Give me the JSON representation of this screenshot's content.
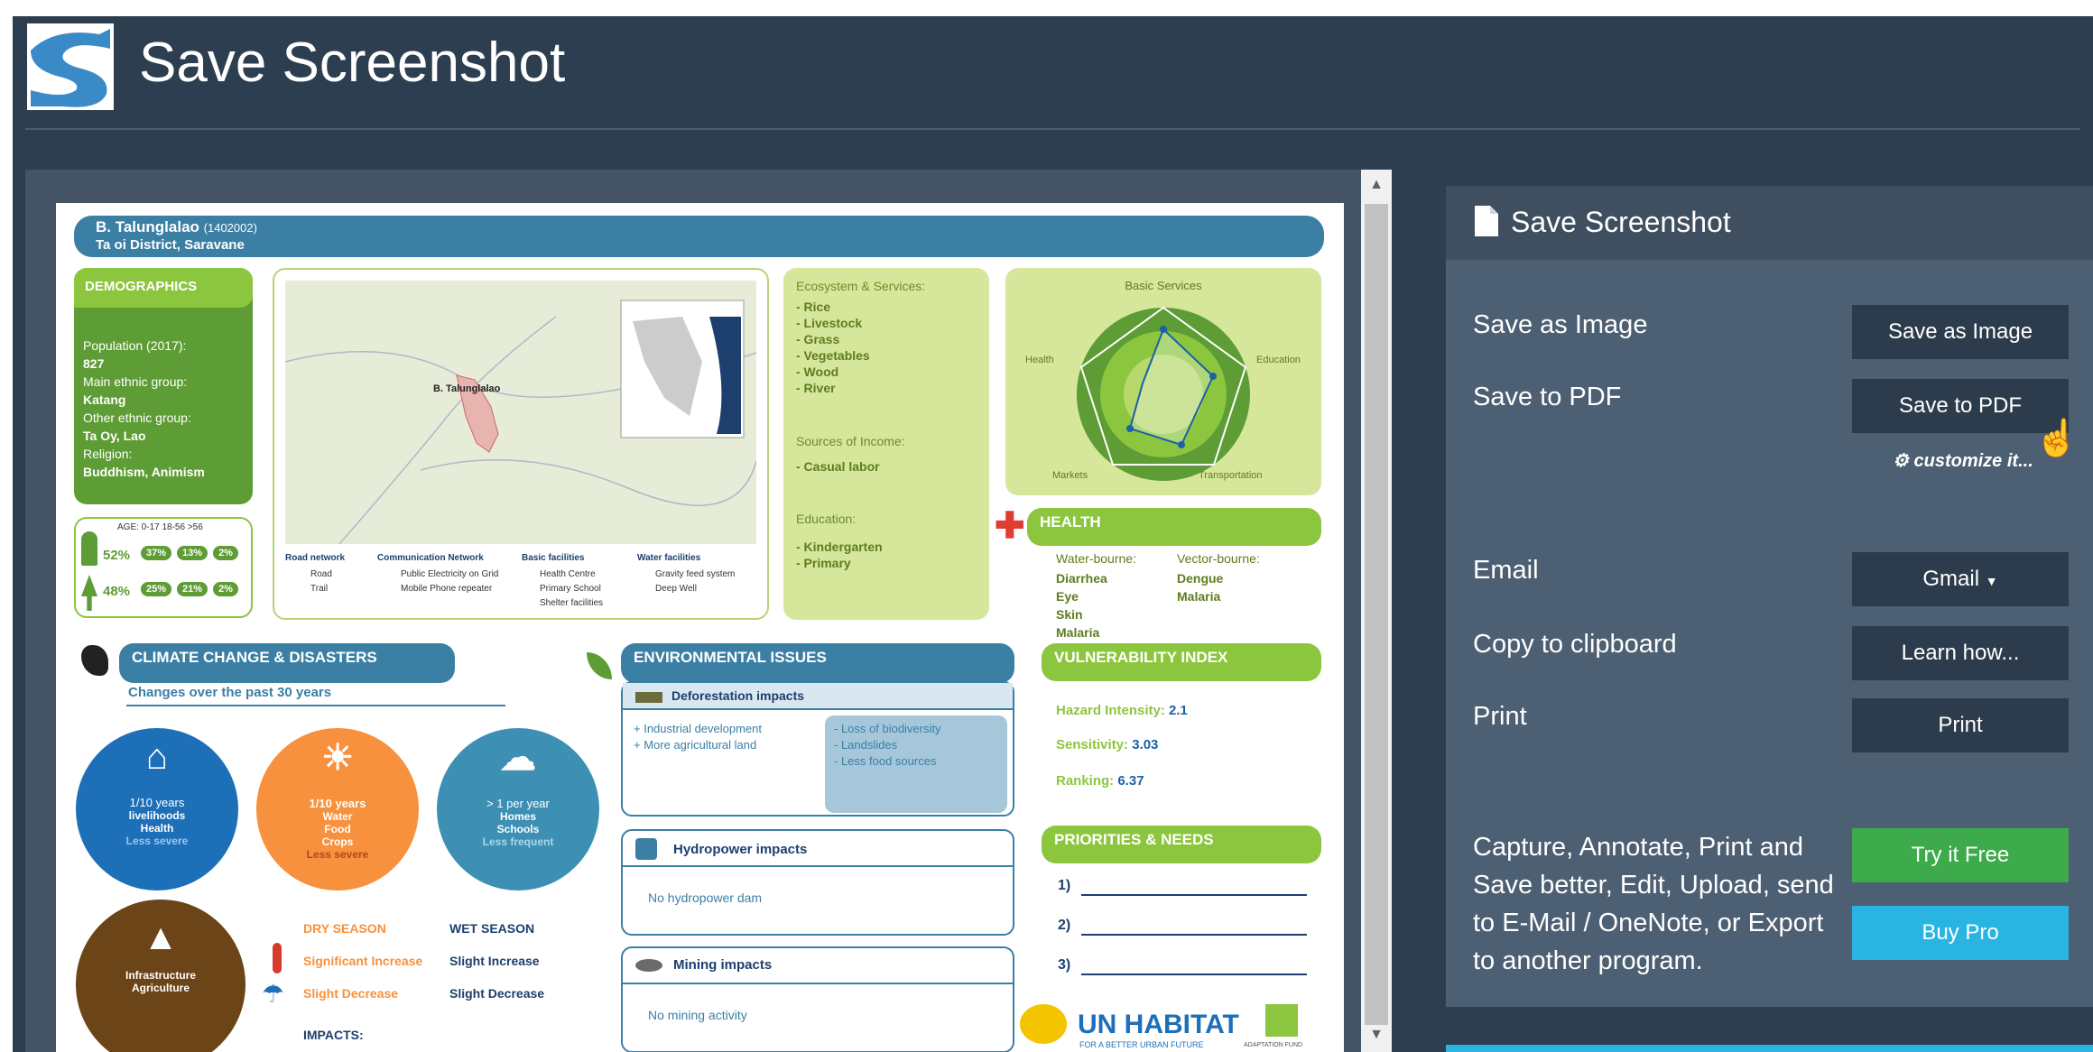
{
  "header": {
    "title": "Save Screenshot"
  },
  "document": {
    "village": "B. Talunglalao",
    "code": "(1402002)",
    "district": "Ta oi District, Saravane",
    "demographics": {
      "title": "DEMOGRAPHICS",
      "pop_label": "Population (2017):",
      "pop_value": "827",
      "ethnic_label": "Main ethnic group:",
      "ethnic_value": "Katang",
      "other_label": "Other ethnic group:",
      "other_value": "Ta Oy, Lao",
      "religion_label": "Religion:",
      "religion_value": "Buddhism, Animism"
    },
    "age": {
      "header": "AGE: 0-17  18-56  >56",
      "male_pct": "52%",
      "male_vals": [
        "37%",
        "13%",
        "2%"
      ],
      "female_pct": "48%",
      "female_vals": [
        "25%",
        "21%",
        "2%"
      ]
    },
    "map": {
      "place": "B. Talunglalao",
      "legend_road": "Road network",
      "legend_comm": "Communication Network",
      "legend_basic": "Basic facilities",
      "legend_water": "Water facilities",
      "road": "Road",
      "trail": "Trail",
      "electricity": "Public Electricity on Grid",
      "phone": "Mobile Phone repeater",
      "health": "Health Centre",
      "school": "Primary School",
      "shelter": "Shelter facilities",
      "gravity": "Gravity feed system",
      "well": "Deep Well"
    },
    "eco": {
      "title": "Ecosystem & Services:",
      "items": [
        "- Rice",
        "- Livestock",
        "- Grass",
        "- Vegetables",
        "- Wood",
        "- River"
      ],
      "income_title": "Sources of Income:",
      "income_items": [
        "- Casual labor"
      ],
      "edu_title": "Education:",
      "edu_items": [
        "- Kindergarten",
        "- Primary"
      ]
    },
    "radar": {
      "title": "Basic Services",
      "health": "Health",
      "education": "Education",
      "markets": "Markets",
      "transport": "Transportation"
    },
    "health": {
      "title": "HEALTH",
      "water_title": "Water-bourne:",
      "water_items": [
        "Diarrhea",
        "Eye",
        "Skin",
        "Malaria"
      ],
      "vector_title": "Vector-bourne:",
      "vector_items": [
        "Dengue",
        "Malaria"
      ]
    },
    "vulnerability": {
      "title": "VULNERABILITY INDEX",
      "hazard_label": "Hazard Intensity:",
      "hazard": "2.1",
      "sens_label": "Sensitivity:",
      "sens": "3.03",
      "rank_label": "Ranking:",
      "rank": "6.37"
    },
    "priorities": {
      "title": "PRIORITIES & NEEDS",
      "items": [
        "1)",
        "2)",
        "3)"
      ]
    },
    "climate": {
      "title": "CLIMATE CHANGE & DISASTERS",
      "subtitle": "Changes over the past 30 years",
      "c1": [
        "1/10 years",
        "livelihoods",
        "Health",
        "Less severe"
      ],
      "c2": [
        "1/10 years",
        "Water",
        "Food",
        "Crops",
        "Less severe"
      ],
      "c3": [
        "> 1 per year",
        "Homes",
        "Schools",
        "Less frequent"
      ],
      "c4": [
        "Infrastructure",
        "Agriculture"
      ],
      "dry": "DRY SEASON",
      "wet": "WET SEASON",
      "sig_inc": "Significant Increase",
      "slight_inc": "Slight Increase",
      "slight_dec": "Slight Decrease",
      "slight_dec2": "Slight Decrease",
      "impacts": "IMPACTS:"
    },
    "env": {
      "title": "ENVIRONMENTAL ISSUES",
      "defor": "Deforestation impacts",
      "left": [
        "+ Industrial development",
        "+ More agricultural land"
      ],
      "right": [
        "- Loss of biodiversity",
        "- Landslides",
        "- Less food sources"
      ],
      "hydro": "Hydropower impacts",
      "hydro_text": "No hydropower dam",
      "mining": "Mining impacts",
      "mining_text": "No mining activity"
    },
    "logos": {
      "unhabitat": "UN HABITAT",
      "unhabitat_sub": "FOR A BETTER URBAN FUTURE",
      "adaptation": "ADAPTATION FUND"
    }
  },
  "panel": {
    "title": "Save Screenshot",
    "save_image_label": "Save as Image",
    "save_image_btn": "Save as Image",
    "save_pdf_label": "Save to PDF",
    "save_pdf_btn": "Save to PDF",
    "customize": "customize it...",
    "email_label": "Email",
    "email_btn": "Gmail",
    "clipboard_label": "Copy to clipboard",
    "clipboard_btn": "Learn how...",
    "print_label": "Print",
    "print_btn": "Print",
    "promo": "Capture, Annotate, Print and Save better, Edit, Upload, send to E-Mail / OneNote, or Export to another program.",
    "try_btn": "Try it Free",
    "buy_btn": "Buy Pro"
  },
  "colors": {
    "header_bg": "#2c3e50",
    "panel_bg": "#4d5f72",
    "green": "#3daa4b",
    "blue": "#29b4e2",
    "doc_blue": "#3b7fa5",
    "doc_green": "#5e9c35"
  }
}
